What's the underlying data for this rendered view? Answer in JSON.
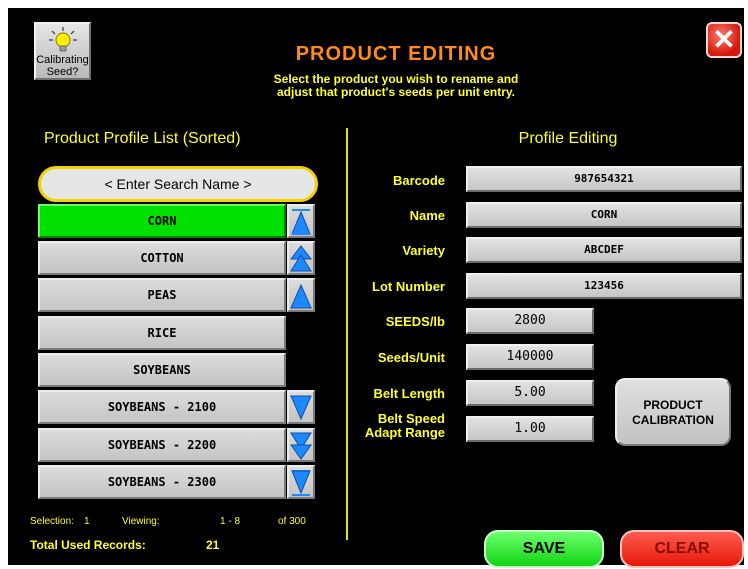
{
  "header": {
    "help_button_label_line1": "Calibrating",
    "help_button_label_line2": "Seed?",
    "title": "PRODUCT EDITING",
    "subtitle_line1": "Select the product you wish to rename and",
    "subtitle_line2": "adjust that product's seeds per unit entry.",
    "close_icon_glyph": "✕"
  },
  "list": {
    "heading": "Product Profile List (Sorted)",
    "search_placeholder": "< Enter Search Name >",
    "items": [
      {
        "label": "CORN",
        "selected": true
      },
      {
        "label": "COTTON",
        "selected": false
      },
      {
        "label": "PEAS",
        "selected": false
      },
      {
        "label": "RICE",
        "selected": false
      },
      {
        "label": "SOYBEANS",
        "selected": false
      },
      {
        "label": "SOYBEANS - 2100",
        "selected": false
      },
      {
        "label": "SOYBEANS - 2200",
        "selected": false
      },
      {
        "label": "SOYBEANS - 2300",
        "selected": false
      }
    ],
    "scroll_icons": [
      "scroll-top-icon",
      "page-up-icon",
      "line-up-icon",
      "line-down-icon",
      "page-down-icon",
      "scroll-bottom-icon"
    ],
    "status": {
      "selection_label": "Selection:",
      "selection_value": "1",
      "viewing_label": "Viewing:",
      "viewing_value": "1 - 8",
      "of_label": "of 300",
      "total_label": "Total Used Records:",
      "total_value": "21"
    }
  },
  "editing": {
    "heading": "Profile Editing",
    "fields": {
      "barcode": {
        "label": "Barcode",
        "value": "987654321"
      },
      "name": {
        "label": "Name",
        "value": "CORN"
      },
      "variety": {
        "label": "Variety",
        "value": "ABCDEF"
      },
      "lot_number": {
        "label": "Lot Number",
        "value": "123456"
      },
      "seeds_lb": {
        "label": "SEEDS/lb",
        "value": "2800"
      },
      "seeds_unit": {
        "label": "Seeds/Unit",
        "value": "140000"
      },
      "belt_length": {
        "label": "Belt Length",
        "value": "5.00"
      },
      "belt_speed_line1": "Belt Speed",
      "belt_speed_line2": "Adapt Range",
      "belt_speed_value": "1.00"
    },
    "calibration_line1": "PRODUCT",
    "calibration_line2": "CALIBRATION"
  },
  "actions": {
    "save_label": "SAVE",
    "clear_label": "CLEAR"
  },
  "colors": {
    "background": "#000000",
    "label_yellow": "#ffff33",
    "title_orange": "#ff8c1a",
    "selected_green": "#00e000",
    "save_green": "#22dd22",
    "clear_red": "#ee2211",
    "scroll_blue": "#1e88ff"
  }
}
